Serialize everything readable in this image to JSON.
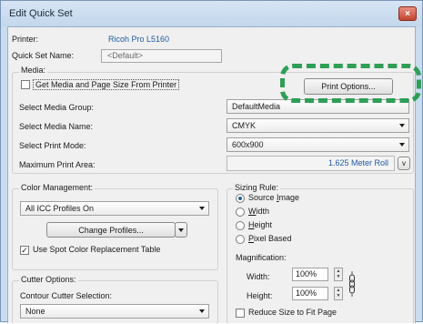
{
  "window": {
    "title": "Edit Quick Set",
    "close_glyph": "×"
  },
  "printer": {
    "label": "Printer:",
    "value": "Ricoh Pro L5160"
  },
  "quick_set_name": {
    "label": "Quick Set Name:",
    "value": "<Default>"
  },
  "media": {
    "label": "Media:",
    "get_media_checkbox": {
      "label": "Get Media and Page Size From Printer",
      "checked": false
    },
    "print_options_button": "Print Options...",
    "select_group": {
      "label": "Select Media Group:",
      "value": "DefaultMedia"
    },
    "select_name": {
      "label": "Select Media Name:",
      "value": "CMYK"
    },
    "select_print_mode": {
      "label": "Select Print Mode:",
      "value": "600x900"
    },
    "max_print_area": {
      "label": "Maximum Print Area:",
      "value": "1.625 Meter Roll",
      "button": "v"
    }
  },
  "color_management": {
    "label": "Color Management:",
    "profile": "All ICC Profiles On",
    "change_profiles_button": "Change Profiles...",
    "spot_color_checkbox": {
      "label": "Use Spot Color Replacement Table",
      "checked": true
    }
  },
  "sizing_rule": {
    "label": "Sizing Rule:",
    "options": [
      {
        "pre": "Source ",
        "accel": "I",
        "post": "mage",
        "checked": true
      },
      {
        "pre": "",
        "accel": "W",
        "post": "idth",
        "checked": false
      },
      {
        "pre": "",
        "accel": "H",
        "post": "eight",
        "checked": false
      },
      {
        "pre": "",
        "accel": "P",
        "post": "ixel Based",
        "checked": false
      }
    ],
    "magnification_label": "Magnification:",
    "width": {
      "label": "Width:",
      "value": "100%"
    },
    "height": {
      "label": "Height:",
      "value": "100%"
    },
    "reduce_checkbox": {
      "label": "Reduce Size to Fit Page",
      "checked": false
    }
  },
  "cutter": {
    "label": "Cutter Options:",
    "contour_label": "Contour Cutter Selection:",
    "value": "None"
  },
  "colors": {
    "highlight_dash": "#2f9e57",
    "printer_name": "#1f5ba3",
    "close_button": "#c2452f"
  }
}
